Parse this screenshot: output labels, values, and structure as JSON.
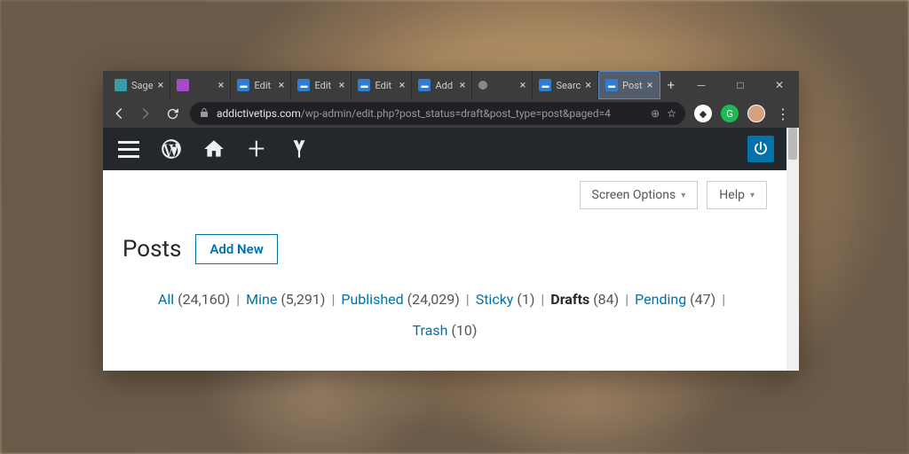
{
  "browser": {
    "tabs": [
      {
        "label": "Sage",
        "favicon": "teal"
      },
      {
        "label": "",
        "favicon": "purple"
      },
      {
        "label": "Edit",
        "favicon": "blue"
      },
      {
        "label": "Edit",
        "favicon": "blue"
      },
      {
        "label": "Edit",
        "favicon": "blue"
      },
      {
        "label": "Add",
        "favicon": "blue"
      },
      {
        "label": "",
        "favicon": "dot"
      },
      {
        "label": "Searc",
        "favicon": "blue"
      },
      {
        "label": "Post",
        "favicon": "blue",
        "active": true
      }
    ],
    "url": {
      "domain": "addictivetips.com",
      "path": "/wp-admin/edit.php?post_status=draft&post_type=post&paged=4"
    }
  },
  "wp": {
    "screen_options": "Screen Options",
    "help": "Help",
    "page_title": "Posts",
    "add_new": "Add New",
    "filters": [
      {
        "label": "All",
        "count": "24,160"
      },
      {
        "label": "Mine",
        "count": "5,291"
      },
      {
        "label": "Published",
        "count": "24,029"
      },
      {
        "label": "Sticky",
        "count": "1"
      },
      {
        "label": "Drafts",
        "count": "84",
        "current": true
      },
      {
        "label": "Pending",
        "count": "47"
      },
      {
        "label": "Trash",
        "count": "10"
      }
    ]
  }
}
